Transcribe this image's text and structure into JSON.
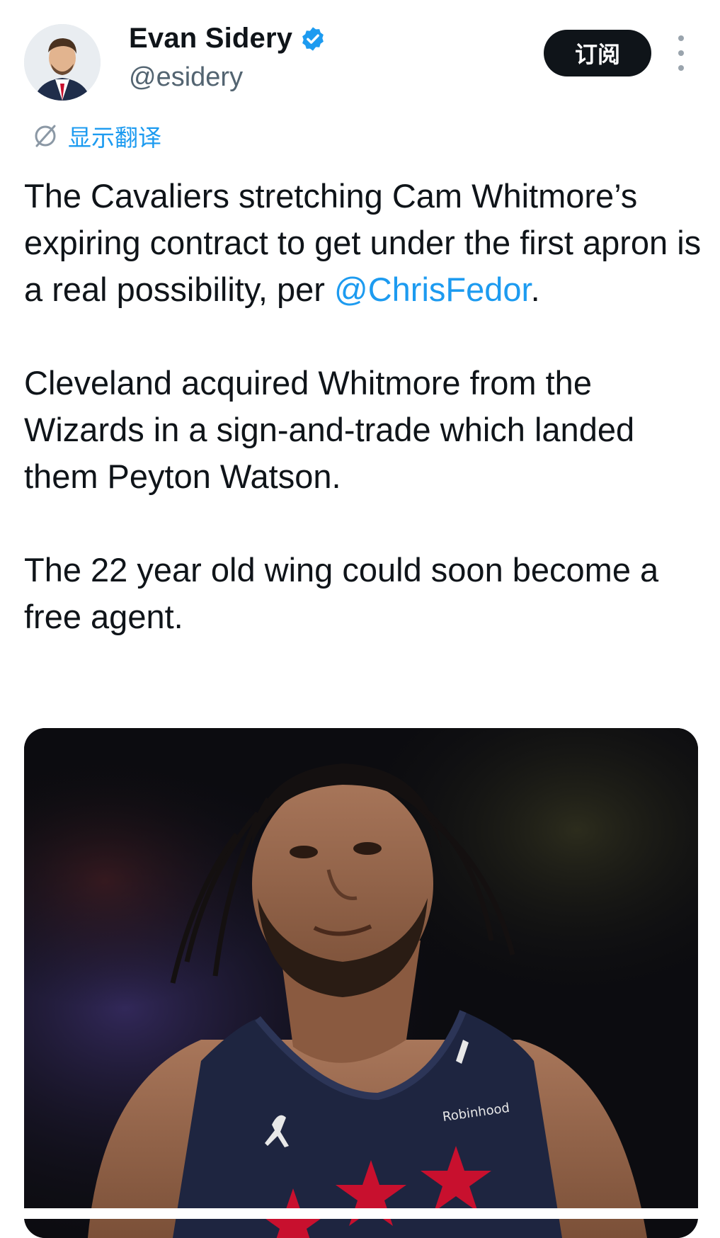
{
  "author": {
    "display_name": "Evan Sidery",
    "handle": "@esidery",
    "verified": true,
    "avatar_icon": "avatar-photo"
  },
  "actions": {
    "subscribe_label": "订阅",
    "more_icon": "more-vertical-icon"
  },
  "translate": {
    "label": "显示翻译",
    "icon": "translate-icon"
  },
  "tweet": {
    "p1_text": "The Cavaliers stretching Cam Whitmore’s expiring contract to get under the first apron is a real possibility, per ",
    "p1_mention": "@ChrisFedor",
    "p1_end": ".",
    "p2": "Cleveland acquired Whitmore from the Wizards in a sign-and-trade which landed them Peyton Watson.",
    "p3": "The 22 year old wing could soon become a free agent."
  },
  "media": {
    "sponsor_text": "Robinhood"
  },
  "colors": {
    "link": "#1d9bf0",
    "button_bg": "#0f1419",
    "verified": "#1d9bf0",
    "secondary_text": "#536471"
  }
}
